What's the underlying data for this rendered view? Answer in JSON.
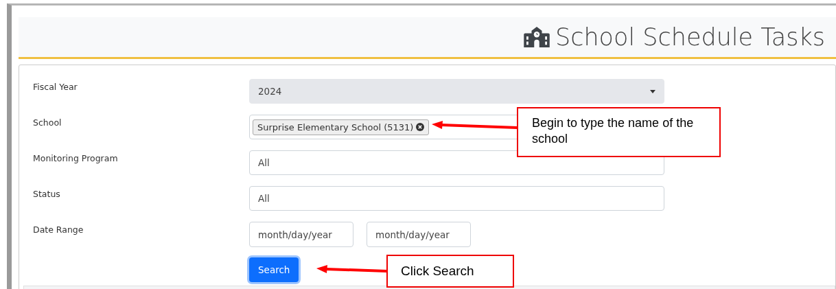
{
  "header": {
    "title": "School Schedule Tasks"
  },
  "form": {
    "rows": [
      {
        "kind": "select",
        "label": "Fiscal Year",
        "value": "2024"
      },
      {
        "kind": "tags",
        "label": "School",
        "tags": [
          "Surprise Elementary School (5131)"
        ]
      },
      {
        "kind": "text",
        "label": "Monitoring Program",
        "value": "All"
      },
      {
        "kind": "text",
        "label": "Status",
        "value": "All"
      },
      {
        "kind": "dates",
        "label": "Date Range",
        "placeholders": [
          "month/day/year",
          "month/day/year"
        ]
      }
    ],
    "button": "Search"
  },
  "annotations": [
    {
      "kind": "field",
      "text": "Begin to type the name of the school"
    },
    {
      "kind": "button",
      "text": "Click Search"
    }
  ]
}
